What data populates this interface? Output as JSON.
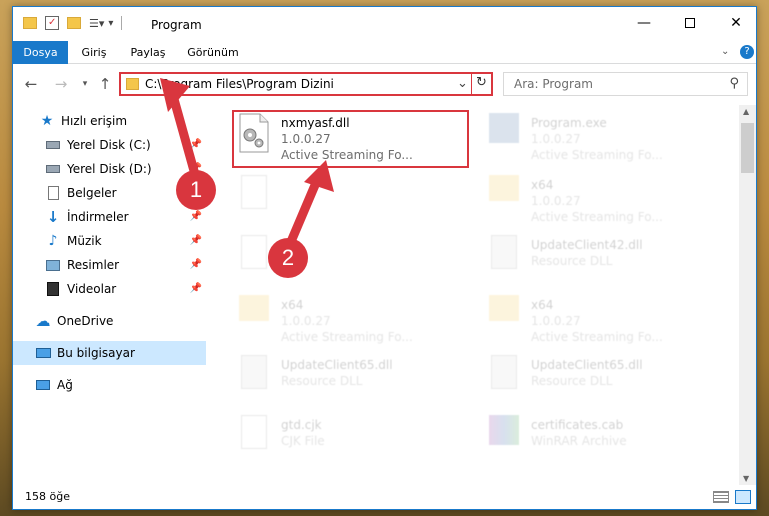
{
  "window": {
    "title": "Program"
  },
  "ribbon": {
    "tabs": [
      "Dosya",
      "Giriş",
      "Paylaş",
      "Görünüm"
    ]
  },
  "address": {
    "path": "C:\\Program Files\\Program Dizini"
  },
  "search": {
    "placeholder": "Ara: Program"
  },
  "nav": {
    "items": [
      {
        "label": "Hızlı erişim",
        "icon": "star-icon"
      },
      {
        "label": "Yerel Disk (C:)",
        "icon": "drive-icon"
      },
      {
        "label": "Yerel Disk (D:)",
        "icon": "drive-icon"
      },
      {
        "label": "Belgeler",
        "icon": "document-icon"
      },
      {
        "label": "İndirmeler",
        "icon": "download-icon"
      },
      {
        "label": "Müzik",
        "icon": "music-icon"
      },
      {
        "label": "Resimler",
        "icon": "picture-icon"
      },
      {
        "label": "Videolar",
        "icon": "video-icon"
      },
      {
        "label": "OneDrive",
        "icon": "cloud-icon"
      },
      {
        "label": "Bu bilgisayar",
        "icon": "computer-icon"
      },
      {
        "label": "Ağ",
        "icon": "network-icon"
      }
    ]
  },
  "files": [
    {
      "name": "nxmyasf.dll",
      "line2": "1.0.0.27",
      "line3": "Active Streaming Fo..."
    },
    {
      "name": "Program.exe",
      "line2": "1.0.0.27",
      "line3": "Active Streaming Fo..."
    },
    {
      "name": "x64",
      "line2": "1.0.0.27",
      "line3": "Active Streaming Fo..."
    },
    {
      "name": "UpdateClient42.dll",
      "line2": "Resource DLL",
      "line3": ""
    },
    {
      "name": "x64",
      "line2": "1.0.0.27",
      "line3": "Active Streaming Fo..."
    },
    {
      "name": "x64",
      "line2": "1.0.0.27",
      "line3": "Active Streaming Fo..."
    },
    {
      "name": "UpdateClient65.dll",
      "line2": "Resource DLL",
      "line3": ""
    },
    {
      "name": "UpdateClient65.dll",
      "line2": "Resource DLL",
      "line3": ""
    },
    {
      "name": "gtd.cjk",
      "line2": "CJK File",
      "line3": ""
    },
    {
      "name": "certificates.cab",
      "line2": "WinRAR Archive",
      "line3": ""
    }
  ],
  "status": {
    "count": "158 öğe"
  },
  "badges": {
    "one": "1",
    "two": "2"
  },
  "colors": {
    "accent": "#1979ca",
    "highlight": "#d9363e"
  }
}
